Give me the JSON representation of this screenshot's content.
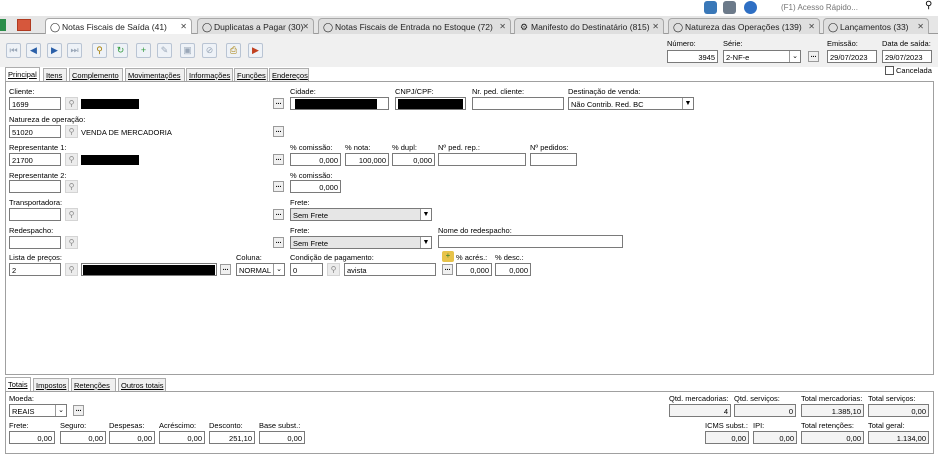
{
  "quick_access": {
    "placeholder": "(F1) Acesso Rápido..."
  },
  "tabs": [
    {
      "label": "Notas Fiscais de Saída (41)",
      "active": true
    },
    {
      "label": "Duplicatas a Pagar (30)",
      "active": false
    },
    {
      "label": "Notas Fiscais de Entrada no Estoque (72)",
      "active": false
    },
    {
      "label": "Manifesto do Destinatário (815)",
      "active": false
    },
    {
      "label": "Natureza das Operações (139)",
      "active": false
    },
    {
      "label": "Lançamentos (33)",
      "active": false
    }
  ],
  "header": {
    "numero_label": "Número:",
    "numero": "3945",
    "serie_label": "Série:",
    "serie": "2-NF-e",
    "emissao_label": "Emissão:",
    "emissao": "29/07/2023",
    "saida_label": "Data de saída:",
    "saida": "29/07/2023",
    "cancelada_label": "Cancelada"
  },
  "main_tabs": [
    "Principal",
    "Itens",
    "Complemento",
    "Movimentações",
    "Informações",
    "Funções",
    "Endereços"
  ],
  "form": {
    "cliente_label": "Cliente:",
    "cliente": "1699",
    "cidade_label": "Cidade:",
    "cnpj_label": "CNPJ/CPF:",
    "ped_cliente_label": "Nr. ped. cliente:",
    "destinacao_label": "Destinação de venda:",
    "destinacao": "Não Contrib. Red. BC",
    "natureza_label": "Natureza de operação:",
    "natureza_codigo": "51020",
    "natureza_desc": "VENDA DE MERCADORIA",
    "rep1_label": "Representante 1:",
    "rep1": "21700",
    "comissao_label": "% comissão:",
    "comissao1": "0,000",
    "nota_label": "% nota:",
    "nota": "100,000",
    "dupl_label": "% dupl:",
    "dupl": "0,000",
    "ped_rep_label": "Nº ped. rep.:",
    "pedidos_label": "Nº pedidos:",
    "rep2_label": "Representante 2:",
    "comissao2_label": "% comissão:",
    "comissao2": "0,000",
    "transportadora_label": "Transportadora:",
    "frete_label": "Frete:",
    "frete": "Sem Frete",
    "redespacho_label": "Redespacho:",
    "frete2_label": "Frete:",
    "frete2": "Sem Frete",
    "nome_redespacho_label": "Nome do redespacho:",
    "lista_label": "Lista de preços:",
    "lista": "2",
    "coluna_label": "Coluna:",
    "coluna": "NORMAL",
    "condicao_label": "Condição de pagamento:",
    "condicao_codigo": "0",
    "condicao_desc": "avista",
    "acres_label": "% acrés.:",
    "acres": "0,000",
    "desc_label": "% desc.:",
    "desc": "0,000"
  },
  "bottom_tabs": [
    "Totais",
    "Impostos",
    "Retenções",
    "Outros totais"
  ],
  "totais": {
    "moeda_label": "Moeda:",
    "moeda": "REAIS",
    "frete_label": "Frete:",
    "frete": "0,00",
    "seguro_label": "Seguro:",
    "seguro": "0,00",
    "despesas_label": "Despesas:",
    "despesas": "0,00",
    "acrescimo_label": "Acréscimo:",
    "acrescimo": "0,00",
    "desconto_label": "Desconto:",
    "desconto": "251,10",
    "base_subst_label": "Base subst.:",
    "base_subst": "0,00",
    "qtd_merc_label": "Qtd. mercadorias:",
    "qtd_merc": "4",
    "qtd_serv_label": "Qtd. serviços:",
    "qtd_serv": "0",
    "total_merc_label": "Total mercadorias:",
    "total_merc": "1.385,10",
    "total_serv_label": "Total serviços:",
    "total_serv": "0,00",
    "icms_subst_label": "ICMS subst.:",
    "icms_subst": "0,00",
    "ipi_label": "IPI:",
    "ipi": "0,00",
    "total_ret_label": "Total retenções:",
    "total_ret": "0,00",
    "total_geral_label": "Total geral:",
    "total_geral": "1.134,00"
  }
}
